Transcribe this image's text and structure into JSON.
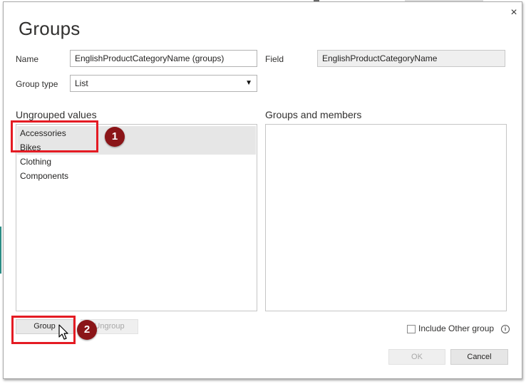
{
  "dialog": {
    "title": "Groups",
    "close_glyph": "×"
  },
  "form": {
    "name_label": "Name",
    "name_value": "EnglishProductCategoryName (groups)",
    "field_label": "Field",
    "field_value": "EnglishProductCategoryName",
    "group_type_label": "Group type",
    "group_type_value": "List",
    "select_glyph": "▼"
  },
  "ungrouped": {
    "heading": "Ungrouped values",
    "items": [
      "Accessories",
      "Bikes",
      "Clothing",
      "Components"
    ],
    "selected": [
      "Accessories",
      "Bikes"
    ]
  },
  "groups": {
    "heading": "Groups and members",
    "items": []
  },
  "buttons": {
    "group": "Group",
    "ungroup": "Ungroup",
    "ok": "OK",
    "cancel": "Cancel"
  },
  "include_other": {
    "label": "Include Other group",
    "checked": false,
    "info_glyph": "i"
  },
  "annotations": {
    "step1": "1",
    "step2": "2",
    "highlight_color": "#e41b23",
    "badge_color": "#8b1518"
  },
  "icons": {
    "close": "close-icon",
    "dropdown": "chevron-down-icon",
    "info": "info-icon",
    "cursor": "mouse-pointer-icon"
  }
}
